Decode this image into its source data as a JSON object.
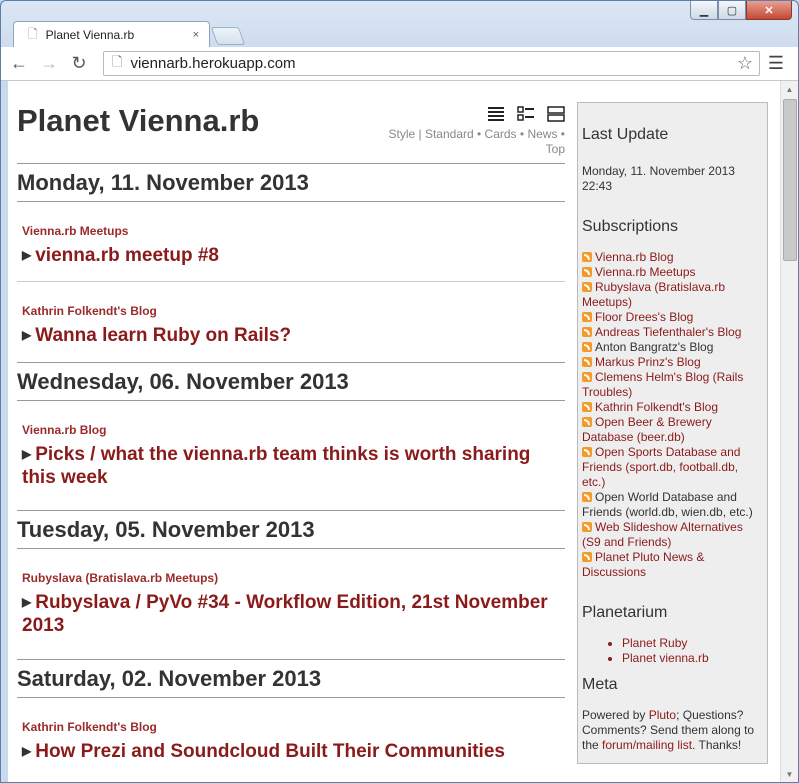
{
  "browser": {
    "tab_title": "Planet Vienna.rb",
    "tab_close": "×",
    "url": "viennarb.herokuapp.com"
  },
  "page": {
    "title": "Planet Vienna.rb",
    "style_links": [
      "Style",
      "Standard",
      "Cards",
      "News",
      "Top"
    ]
  },
  "days": [
    {
      "date": "Monday, 11. November 2013",
      "posts": [
        {
          "feed": "Vienna.rb Meetups",
          "title": "vienna.rb meetup #8"
        },
        {
          "feed": "Kathrin Folkendt's Blog",
          "title": "Wanna learn Ruby on Rails?"
        }
      ]
    },
    {
      "date": "Wednesday, 06. November 2013",
      "posts": [
        {
          "feed": "Vienna.rb Blog",
          "title": "Picks / what the vienna.rb team thinks is worth sharing this week"
        }
      ]
    },
    {
      "date": "Tuesday, 05. November 2013",
      "posts": [
        {
          "feed": "Rubyslava (Bratislava.rb Meetups)",
          "title": "Rubyslava / PyVo #34 - Workflow Edition, 21st November 2013"
        }
      ]
    },
    {
      "date": "Saturday, 02. November 2013",
      "posts": [
        {
          "feed": "Kathrin Folkendt's Blog",
          "title": "How Prezi and Soundcloud Built Their Communities"
        }
      ]
    }
  ],
  "sidebar": {
    "last_update_heading": "Last Update",
    "last_update_value": "Monday, 11. November 2013 22:43",
    "subscriptions_heading": "Subscriptions",
    "subscriptions": [
      "Vienna.rb Blog",
      "Vienna.rb Meetups",
      "Rubyslava (Bratislava.rb Meetups)",
      "Floor Drees's Blog",
      "Andreas Tiefenthaler's Blog",
      "Anton Bangratz's Blog",
      "Markus Prinz's Blog",
      "Clemens Helm's Blog (Rails Troubles)",
      "Kathrin Folkendt's Blog",
      "Open Beer & Brewery Database (beer.db)",
      "Open Sports Database and Friends (sport.db, football.db, etc.)",
      "Open World Database and Friends (world.db, wien.db, etc.)",
      "Web Slideshow Alternatives (S9 and Friends)",
      "Planet Pluto News & Discussions"
    ],
    "planetarium_heading": "Planetarium",
    "planetarium": [
      "Planet Ruby",
      "Planet vienna.rb"
    ],
    "meta_heading": "Meta",
    "meta_text_1": "Powered by ",
    "meta_link_pluto": "Pluto",
    "meta_text_2": "; Questions? Comments? Send them along to the ",
    "meta_link_forum": "forum/mailing list",
    "meta_text_3": ". Thanks!"
  }
}
